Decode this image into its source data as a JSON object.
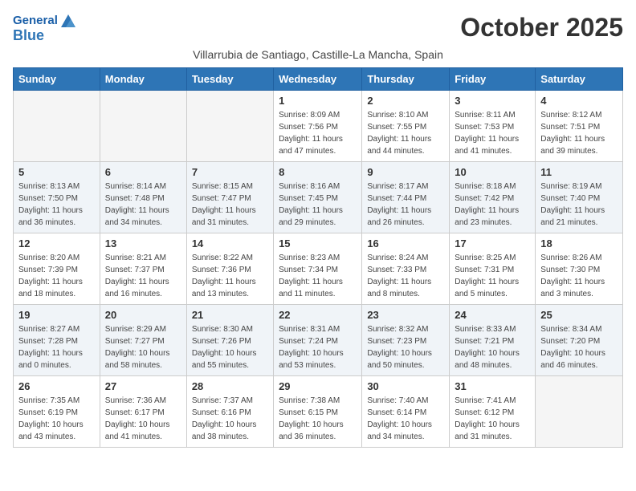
{
  "header": {
    "logo_general": "General",
    "logo_blue": "Blue",
    "month_title": "October 2025",
    "subtitle": "Villarrubia de Santiago, Castille-La Mancha, Spain"
  },
  "weekdays": [
    "Sunday",
    "Monday",
    "Tuesday",
    "Wednesday",
    "Thursday",
    "Friday",
    "Saturday"
  ],
  "weeks": [
    [
      {
        "day": "",
        "info": ""
      },
      {
        "day": "",
        "info": ""
      },
      {
        "day": "",
        "info": ""
      },
      {
        "day": "1",
        "info": "Sunrise: 8:09 AM\nSunset: 7:56 PM\nDaylight: 11 hours and 47 minutes."
      },
      {
        "day": "2",
        "info": "Sunrise: 8:10 AM\nSunset: 7:55 PM\nDaylight: 11 hours and 44 minutes."
      },
      {
        "day": "3",
        "info": "Sunrise: 8:11 AM\nSunset: 7:53 PM\nDaylight: 11 hours and 41 minutes."
      },
      {
        "day": "4",
        "info": "Sunrise: 8:12 AM\nSunset: 7:51 PM\nDaylight: 11 hours and 39 minutes."
      }
    ],
    [
      {
        "day": "5",
        "info": "Sunrise: 8:13 AM\nSunset: 7:50 PM\nDaylight: 11 hours and 36 minutes."
      },
      {
        "day": "6",
        "info": "Sunrise: 8:14 AM\nSunset: 7:48 PM\nDaylight: 11 hours and 34 minutes."
      },
      {
        "day": "7",
        "info": "Sunrise: 8:15 AM\nSunset: 7:47 PM\nDaylight: 11 hours and 31 minutes."
      },
      {
        "day": "8",
        "info": "Sunrise: 8:16 AM\nSunset: 7:45 PM\nDaylight: 11 hours and 29 minutes."
      },
      {
        "day": "9",
        "info": "Sunrise: 8:17 AM\nSunset: 7:44 PM\nDaylight: 11 hours and 26 minutes."
      },
      {
        "day": "10",
        "info": "Sunrise: 8:18 AM\nSunset: 7:42 PM\nDaylight: 11 hours and 23 minutes."
      },
      {
        "day": "11",
        "info": "Sunrise: 8:19 AM\nSunset: 7:40 PM\nDaylight: 11 hours and 21 minutes."
      }
    ],
    [
      {
        "day": "12",
        "info": "Sunrise: 8:20 AM\nSunset: 7:39 PM\nDaylight: 11 hours and 18 minutes."
      },
      {
        "day": "13",
        "info": "Sunrise: 8:21 AM\nSunset: 7:37 PM\nDaylight: 11 hours and 16 minutes."
      },
      {
        "day": "14",
        "info": "Sunrise: 8:22 AM\nSunset: 7:36 PM\nDaylight: 11 hours and 13 minutes."
      },
      {
        "day": "15",
        "info": "Sunrise: 8:23 AM\nSunset: 7:34 PM\nDaylight: 11 hours and 11 minutes."
      },
      {
        "day": "16",
        "info": "Sunrise: 8:24 AM\nSunset: 7:33 PM\nDaylight: 11 hours and 8 minutes."
      },
      {
        "day": "17",
        "info": "Sunrise: 8:25 AM\nSunset: 7:31 PM\nDaylight: 11 hours and 5 minutes."
      },
      {
        "day": "18",
        "info": "Sunrise: 8:26 AM\nSunset: 7:30 PM\nDaylight: 11 hours and 3 minutes."
      }
    ],
    [
      {
        "day": "19",
        "info": "Sunrise: 8:27 AM\nSunset: 7:28 PM\nDaylight: 11 hours and 0 minutes."
      },
      {
        "day": "20",
        "info": "Sunrise: 8:29 AM\nSunset: 7:27 PM\nDaylight: 10 hours and 58 minutes."
      },
      {
        "day": "21",
        "info": "Sunrise: 8:30 AM\nSunset: 7:26 PM\nDaylight: 10 hours and 55 minutes."
      },
      {
        "day": "22",
        "info": "Sunrise: 8:31 AM\nSunset: 7:24 PM\nDaylight: 10 hours and 53 minutes."
      },
      {
        "day": "23",
        "info": "Sunrise: 8:32 AM\nSunset: 7:23 PM\nDaylight: 10 hours and 50 minutes."
      },
      {
        "day": "24",
        "info": "Sunrise: 8:33 AM\nSunset: 7:21 PM\nDaylight: 10 hours and 48 minutes."
      },
      {
        "day": "25",
        "info": "Sunrise: 8:34 AM\nSunset: 7:20 PM\nDaylight: 10 hours and 46 minutes."
      }
    ],
    [
      {
        "day": "26",
        "info": "Sunrise: 7:35 AM\nSunset: 6:19 PM\nDaylight: 10 hours and 43 minutes."
      },
      {
        "day": "27",
        "info": "Sunrise: 7:36 AM\nSunset: 6:17 PM\nDaylight: 10 hours and 41 minutes."
      },
      {
        "day": "28",
        "info": "Sunrise: 7:37 AM\nSunset: 6:16 PM\nDaylight: 10 hours and 38 minutes."
      },
      {
        "day": "29",
        "info": "Sunrise: 7:38 AM\nSunset: 6:15 PM\nDaylight: 10 hours and 36 minutes."
      },
      {
        "day": "30",
        "info": "Sunrise: 7:40 AM\nSunset: 6:14 PM\nDaylight: 10 hours and 34 minutes."
      },
      {
        "day": "31",
        "info": "Sunrise: 7:41 AM\nSunset: 6:12 PM\nDaylight: 10 hours and 31 minutes."
      },
      {
        "day": "",
        "info": ""
      }
    ]
  ]
}
